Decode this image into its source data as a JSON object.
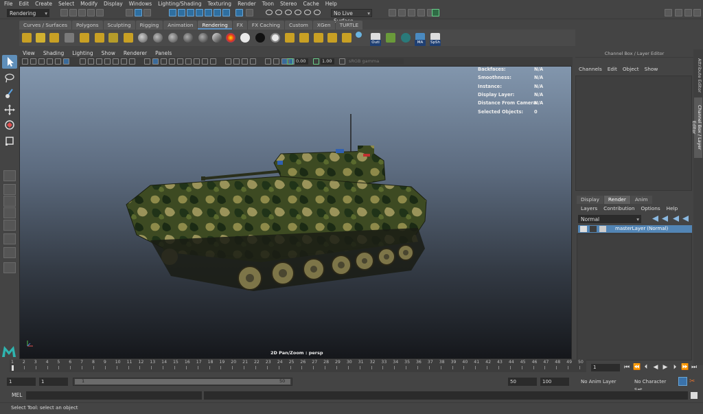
{
  "menubar": [
    "File",
    "Edit",
    "Create",
    "Select",
    "Modify",
    "Display",
    "Windows",
    "Lighting/Shading",
    "Texturing",
    "Render",
    "Toon",
    "Stereo",
    "Cache",
    "Help"
  ],
  "status_line": {
    "menu_set": "Rendering",
    "live_surface": "No Live Surface"
  },
  "shelf_tabs": [
    {
      "label": "Curves / Surfaces"
    },
    {
      "label": "Polygons"
    },
    {
      "label": "Sculpting"
    },
    {
      "label": "Rigging"
    },
    {
      "label": "Animation"
    },
    {
      "label": "Rendering",
      "active": true
    },
    {
      "label": "FX"
    },
    {
      "label": "FX Caching"
    },
    {
      "label": "Custom"
    },
    {
      "label": "XGen"
    },
    {
      "label": "TURTLE"
    }
  ],
  "shelf_labels": {
    "outliner": "Outl",
    "mental_ray": "MA",
    "spreadsheet": "SpSh"
  },
  "viewport": {
    "menu": [
      "View",
      "Shading",
      "Lighting",
      "Show",
      "Renderer",
      "Panels"
    ],
    "exposure": "0.00",
    "gamma": "1.00",
    "color_space": "sRGB gamma",
    "camera_label": "2D Pan/Zoom : persp",
    "hud": [
      {
        "label": "Backfaces:",
        "value": "N/A"
      },
      {
        "label": "Smoothness:",
        "value": "N/A"
      },
      {
        "label": "Instance:",
        "value": "N/A"
      },
      {
        "label": "Display Layer:",
        "value": "N/A"
      },
      {
        "label": "Distance From Camera:",
        "value": "N/A"
      },
      {
        "label": "Selected Objects:",
        "value": "0"
      }
    ]
  },
  "channel_box": {
    "title": "Channel Box / Layer Editor",
    "menu": [
      "Channels",
      "Edit",
      "Object",
      "Show"
    ]
  },
  "side_tabs": [
    "Attribute Editor",
    "Channel Box / Layer Editor"
  ],
  "layer_editor": {
    "tabs": [
      {
        "label": "Display"
      },
      {
        "label": "Render",
        "active": true
      },
      {
        "label": "Anim"
      }
    ],
    "menu": [
      "Layers",
      "Contribution",
      "Options",
      "Help"
    ],
    "blend_mode": "Normal",
    "layer_name": "masterLayer (Normal)"
  },
  "time_slider": {
    "ticks": [
      "1",
      "2",
      "3",
      "4",
      "5",
      "6",
      "7",
      "8",
      "9",
      "10",
      "11",
      "12",
      "13",
      "14",
      "15",
      "16",
      "17",
      "18",
      "19",
      "20",
      "21",
      "22",
      "23",
      "24",
      "25",
      "26",
      "27",
      "28",
      "29",
      "30",
      "31",
      "32",
      "33",
      "34",
      "35",
      "36",
      "37",
      "38",
      "39",
      "40",
      "41",
      "42",
      "43",
      "44",
      "45",
      "46",
      "47",
      "48",
      "49",
      "50"
    ],
    "current_frame": "1"
  },
  "range_slider": {
    "start": "1",
    "playback_start": "1",
    "range_start_label": "1",
    "range_end_label": "50",
    "playback_end": "50",
    "end": "100",
    "anim_layer": "No Anim Layer",
    "character_set": "No Character Set"
  },
  "command_line": {
    "label": "MEL"
  },
  "help_line": "Select Tool: select an object",
  "colors": {
    "accent": "#5285b5",
    "panel": "#444444",
    "field": "#2b2b2b"
  }
}
